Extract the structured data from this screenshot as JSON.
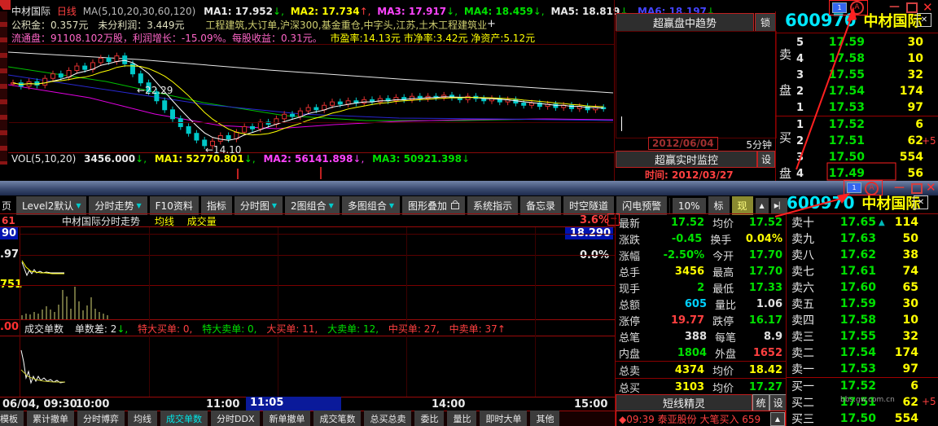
{
  "top_window": {
    "title": {
      "stock": "中材国际",
      "period": "日线",
      "ma_setting": "MA(5,10,20,30,60,120)",
      "mas": [
        {
          "t": "MA1: 17.952",
          "a": "↓,"
        },
        {
          "t": "MA2: 17.734",
          "a": "↑,"
        },
        {
          "t": "MA3: 17.917",
          "a": "↓,"
        },
        {
          "t": "MA4: 18.459",
          "a": "↓,"
        },
        {
          "t": "MA5: 18.819",
          "a": "↓,"
        },
        {
          "t": "MA6: 18.197",
          "a": "↓"
        }
      ]
    },
    "info1": {
      "a": "公积金：0.357元",
      "b": "未分利润：3.449元",
      "c": "工程建筑,大订单,沪深300,基金重仓,中字头,江苏,土木工程建筑业"
    },
    "info2": {
      "a": "流通盘：91108.102万股，利润增长：-15.09%。每股收益：0.31元。",
      "b": "市盈率:14.13元 市净率:3.42元 净资产:5.12元"
    },
    "annot_high": "←22.29",
    "annot_low": "←14.10",
    "vol_row": {
      "label": "VOL(5,10,20)",
      "value": "3456.000",
      "a": "↓,",
      "ma1": "MA1: 52770.801",
      "a1": "↓,",
      "ma2": "MA2: 56141.898",
      "a2": "↓,",
      "ma3": "MA3: 50921.398",
      "a3": "↓"
    }
  },
  "trend_panel": {
    "title": "超赢盘中趋势",
    "lock": "锁",
    "date": "2012/06/04",
    "period": "5分钟",
    "monitor": "超赢实时监控",
    "set": "设",
    "time": "时间: 2012/03/27"
  },
  "book_top": {
    "code": "600970",
    "name": "中材国际",
    "close": "✕",
    "sell1": "卖",
    "sell2": "盘",
    "buy1": "买",
    "buy2": "盘",
    "plus": "+5",
    "rows_sell": [
      [
        "5",
        "17.59",
        "30"
      ],
      [
        "4",
        "17.58",
        "10"
      ],
      [
        "3",
        "17.55",
        "32"
      ],
      [
        "2",
        "17.54",
        "174"
      ],
      [
        "1",
        "17.53",
        "97"
      ]
    ],
    "rows_buy": [
      [
        "1",
        "17.52",
        "6"
      ],
      [
        "2",
        "17.51",
        "62"
      ],
      [
        "3",
        "17.50",
        "554"
      ],
      [
        "4",
        "17.49",
        "56"
      ]
    ]
  },
  "toolbar": {
    "partial": "页",
    "tabs": [
      "Level2默认",
      "分时走势",
      "F10资料",
      "指标",
      "分时图",
      "2图组合",
      "多图组合",
      "图形叠加",
      "系统指示",
      "备忘录",
      "时空隧道",
      "闪电预警"
    ],
    "zoom": "10%",
    "biao": "标",
    "xian": "现"
  },
  "bottom_title": {
    "code": "600970",
    "name": "中材国际",
    "close": "✕"
  },
  "intraday": {
    "header_title": "中材国际分时走势",
    "header_ma": "均线",
    "header_vol": "成交量",
    "left1": "61",
    "left2": "90",
    "left3": ".97",
    "left4": "751",
    "left5": ".00",
    "right1": "3.6%",
    "right2": "18.290",
    "right3": "0.0%",
    "stats": {
      "s0": "成交单数",
      "s1": "单数差: 2",
      "s1a": "↓,",
      "s2": "特大买单: 0,",
      "s3": "特大卖单: 0,",
      "s4": "大买单: 11,",
      "s5": "大卖单: 12,",
      "s6": "中买单: 27,",
      "s7": "中卖单: 37",
      "s7a": "↑"
    },
    "time": {
      "d": "06/04, 09:30",
      "t1": "10:00",
      "t2": "11:00",
      "sel": "11:05",
      "t3": "14:00",
      "t4": "15:00"
    },
    "tabs": [
      "模板",
      "累计撤单",
      "分时博弈",
      "均线",
      "成交单数",
      "分时DDX",
      "新单撤单",
      "成交笔数",
      "总买总卖",
      "委比",
      "量比",
      "即时大单",
      "其他"
    ]
  },
  "quote": {
    "rows": [
      [
        "最新",
        "17.52",
        "均价",
        "17.52"
      ],
      [
        "涨跌",
        "-0.45",
        "换手",
        "0.04%"
      ],
      [
        "涨幅",
        "-2.50%",
        "今开",
        "17.70"
      ],
      [
        "总手",
        "3456",
        "最高",
        "17.70"
      ],
      [
        "现手",
        "2",
        "最低",
        "17.33"
      ],
      [
        "总额",
        "605",
        "量比",
        "1.06"
      ],
      [
        "涨停",
        "19.77",
        "跌停",
        "16.17"
      ],
      [
        "总笔",
        "388",
        "每笔",
        "8.9"
      ],
      [
        "内盘",
        "1804",
        "外盘",
        "1652"
      ],
      [
        "总卖",
        "4374",
        "均价",
        "18.42"
      ],
      [
        "总买",
        "3103",
        "均价",
        "17.27"
      ]
    ]
  },
  "shortline": {
    "title": "短线精灵",
    "btn1": "统",
    "btn2": "设",
    "alert": "◆09:39 泰亚股份 大笔买入 659",
    "up": "▲"
  },
  "book10": {
    "arrow": "▲",
    "plus": "+5",
    "rows": [
      [
        "卖十",
        "17.65",
        "114"
      ],
      [
        "卖九",
        "17.63",
        "50"
      ],
      [
        "卖八",
        "17.62",
        "38"
      ],
      [
        "卖七",
        "17.61",
        "74"
      ],
      [
        "卖六",
        "17.60",
        "65"
      ],
      [
        "卖五",
        "17.59",
        "30"
      ],
      [
        "卖四",
        "17.58",
        "10"
      ],
      [
        "卖三",
        "17.55",
        "32"
      ],
      [
        "卖二",
        "17.54",
        "174"
      ],
      [
        "卖一",
        "17.53",
        "97"
      ],
      [
        "买一",
        "17.52",
        "6"
      ],
      [
        "买二",
        "17.51",
        "62"
      ],
      [
        "买三",
        "17.50",
        "554"
      ]
    ]
  },
  "watermark": "bbs.gw.com.cn",
  "chart_data": {
    "type": "candlestick",
    "title": "中材国际 日线",
    "daily": {
      "ylim": [
        13.9,
        22.9
      ],
      "closes": [
        19.8,
        19.5,
        19.9,
        19.6,
        20.2,
        20.6,
        20.3,
        20.9,
        21.3,
        21.0,
        21.6,
        22.0,
        21.7,
        22.2,
        21.5,
        20.6,
        19.8,
        19.0,
        18.2,
        17.4,
        16.6,
        15.9,
        15.3,
        14.7,
        14.2,
        14.6,
        15.1,
        14.8,
        15.4,
        15.9,
        15.7,
        16.3,
        16.1,
        16.6,
        17.0,
        16.8,
        17.3,
        17.6,
        17.4,
        17.8,
        18.1,
        17.9,
        18.2,
        18.0,
        18.3,
        18.1,
        18.4,
        18.2,
        18.5,
        18.3,
        18.6,
        18.4,
        18.6,
        18.5,
        18.7,
        18.5,
        18.3,
        18.6,
        18.4,
        18.2,
        18.4,
        18.1,
        18.3,
        18.0,
        17.8,
        18.0,
        17.7,
        17.9,
        17.6,
        17.8,
        17.5,
        17.7,
        17.4,
        17.6,
        17.52
      ],
      "annotations": {
        "high": 22.29,
        "low": 14.1
      },
      "ma_long": [
        {
          "name": "MA120",
          "color": "#e8e8e8",
          "pts": [
            [
              0,
              8
            ],
            [
              160,
              17
            ],
            [
              320,
              30
            ],
            [
              480,
              41
            ],
            [
              620,
              50
            ],
            [
              743,
              58
            ]
          ]
        },
        {
          "name": "MA60",
          "color": "#00c000",
          "pts": [
            [
              0,
              26
            ],
            [
              120,
              44
            ],
            [
              240,
              70
            ],
            [
              340,
              86
            ],
            [
              440,
              92
            ],
            [
              560,
              92
            ],
            [
              660,
              90
            ],
            [
              743,
              92
            ]
          ]
        },
        {
          "name": "MA30",
          "color": "#e000e0",
          "pts": [
            [
              0,
              48
            ],
            [
              100,
              64
            ],
            [
              180,
              84
            ],
            [
              260,
              98
            ],
            [
              330,
              102
            ],
            [
              400,
              97
            ],
            [
              480,
              93
            ],
            [
              560,
              91
            ],
            [
              660,
              90
            ],
            [
              743,
              91
            ]
          ]
        },
        {
          "name": "MA-blue",
          "color": "#2828d0",
          "pts": [
            [
              0,
              36
            ],
            [
              120,
              54
            ],
            [
              240,
              72
            ],
            [
              360,
              84
            ],
            [
              480,
              89
            ],
            [
              600,
              90
            ],
            [
              743,
              92
            ]
          ]
        }
      ]
    },
    "intraday": {
      "price": [
        [
          3,
          44
        ],
        [
          6,
          52
        ],
        [
          9,
          60
        ],
        [
          12,
          54
        ],
        [
          15,
          58
        ],
        [
          18,
          53
        ],
        [
          21,
          57
        ],
        [
          25,
          55
        ],
        [
          29,
          57
        ],
        [
          33,
          56
        ],
        [
          38,
          57
        ],
        [
          44,
          57
        ],
        [
          50,
          57
        ],
        [
          55,
          57
        ]
      ],
      "avg": [
        [
          3,
          42
        ],
        [
          8,
          50
        ],
        [
          14,
          55
        ],
        [
          20,
          56
        ],
        [
          26,
          57
        ],
        [
          32,
          57
        ],
        [
          40,
          58
        ],
        [
          50,
          58
        ],
        [
          55,
          58
        ]
      ],
      "vol": [
        5,
        7,
        6,
        9,
        7,
        12,
        16,
        12,
        9,
        18,
        36,
        28,
        13,
        40,
        22,
        11,
        17,
        27,
        13,
        9,
        7,
        5
      ],
      "lower": [
        [
          2,
          18
        ],
        [
          5,
          32
        ],
        [
          8,
          52
        ],
        [
          11,
          44
        ],
        [
          14,
          58
        ],
        [
          17,
          50
        ],
        [
          20,
          56
        ],
        [
          23,
          50
        ],
        [
          26,
          55
        ],
        [
          30,
          52
        ],
        [
          34,
          56
        ],
        [
          38,
          54
        ],
        [
          42,
          57
        ],
        [
          46,
          55
        ],
        [
          50,
          58
        ],
        [
          56,
          57
        ]
      ],
      "lower2": [
        [
          2,
          42
        ],
        [
          10,
          50
        ],
        [
          20,
          54
        ],
        [
          30,
          56
        ],
        [
          42,
          57
        ],
        [
          56,
          57
        ]
      ]
    }
  }
}
